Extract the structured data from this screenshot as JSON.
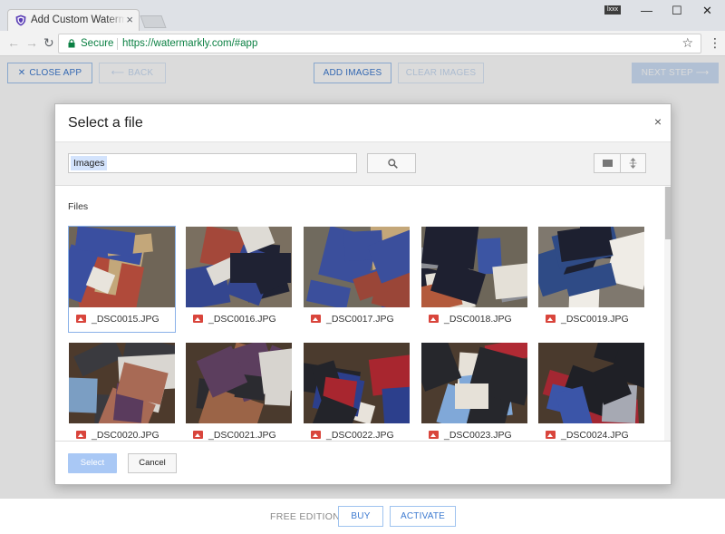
{
  "browser": {
    "tab_title": "Add Custom Watermarks",
    "tab_close": "×",
    "profile_badge": "lxxx",
    "window": {
      "minimize": "—",
      "maximize": "☐",
      "close": "✕"
    },
    "nav": {
      "back": "←",
      "forward": "→",
      "reload": "↻"
    },
    "secure_label": "Secure",
    "url": "https://watermarkly.com/#app",
    "star": "☆",
    "menu": "⋮"
  },
  "app": {
    "close_app": "CLOSE APP",
    "close_app_icon": "✕",
    "back": "BACK",
    "back_icon": "⟵",
    "add_images": "ADD IMAGES",
    "clear_images": "CLEAR IMAGES",
    "next_step": "NEXT STEP",
    "next_step_icon": "⟶",
    "footer": {
      "edition": "FREE EDITION",
      "buy": "BUY",
      "activate": "ACTIVATE"
    }
  },
  "dialog": {
    "title": "Select a file",
    "close": "×",
    "search_chip": "Images",
    "search_value": "",
    "section_label": "Files",
    "select_button": "Select",
    "cancel_button": "Cancel",
    "selected_index": 0,
    "files": [
      {
        "name": "_DSC0015.JPG"
      },
      {
        "name": "_DSC0016.JPG"
      },
      {
        "name": "_DSC0017.JPG"
      },
      {
        "name": "_DSC0018.JPG"
      },
      {
        "name": "_DSC0019.JPG"
      },
      {
        "name": "_DSC0020.JPG"
      },
      {
        "name": "_DSC0021.JPG"
      },
      {
        "name": "_DSC0022.JPG"
      },
      {
        "name": "_DSC0023.JPG"
      },
      {
        "name": "_DSC0024.JPG"
      }
    ]
  },
  "colors": {
    "accent": "#3d7ad0",
    "secure_green": "#0b8043",
    "file_icon_red": "#d9453c",
    "select_button_bg": "#a9c8f5"
  },
  "icons": {
    "favicon": "shield-icon",
    "lock": "lock-icon",
    "search": "search-icon",
    "grid_view": "grid-view-icon",
    "sort": "sort-icon",
    "file_type": "image-file-icon"
  }
}
